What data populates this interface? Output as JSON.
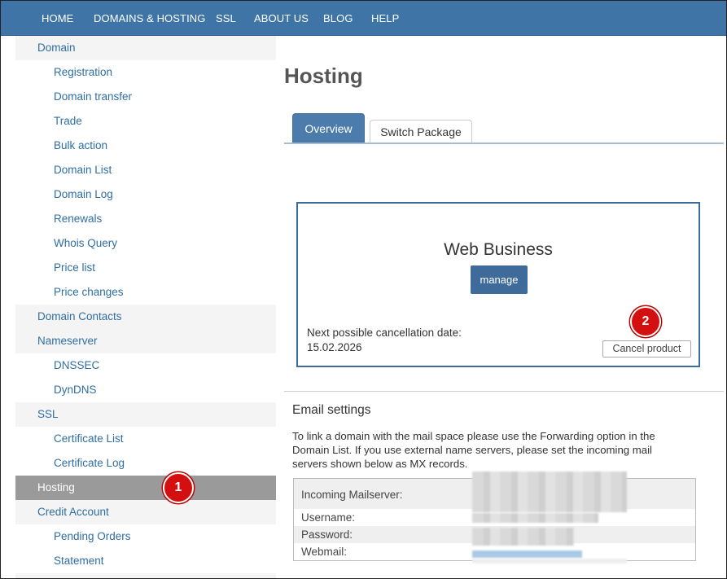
{
  "topnav": {
    "items": [
      "HOME",
      "DOMAINS & HOSTING",
      "SSL",
      "ABOUT US",
      "BLOG",
      "HELP"
    ]
  },
  "sidebar": {
    "items": [
      {
        "label": "Domain",
        "level": 1
      },
      {
        "label": "Registration",
        "level": 2
      },
      {
        "label": "Domain transfer",
        "level": 2
      },
      {
        "label": "Trade",
        "level": 2
      },
      {
        "label": "Bulk action",
        "level": 2
      },
      {
        "label": "Domain List",
        "level": 2
      },
      {
        "label": "Domain Log",
        "level": 2
      },
      {
        "label": "Renewals",
        "level": 2
      },
      {
        "label": "Whois Query",
        "level": 2
      },
      {
        "label": "Price list",
        "level": 2
      },
      {
        "label": "Price changes",
        "level": 2
      },
      {
        "label": "Domain Contacts",
        "level": 1
      },
      {
        "label": "Nameserver",
        "level": 1
      },
      {
        "label": "DNSSEC",
        "level": 2
      },
      {
        "label": "DynDNS",
        "level": 2
      },
      {
        "label": "SSL",
        "level": 1
      },
      {
        "label": "Certificate List",
        "level": 2
      },
      {
        "label": "Certificate Log",
        "level": 2
      },
      {
        "label": "Hosting",
        "level": 1,
        "active": true
      },
      {
        "label": "Credit Account",
        "level": 1
      },
      {
        "label": "Pending Orders",
        "level": 2
      },
      {
        "label": "Statement",
        "level": 2
      }
    ]
  },
  "annotations": {
    "badge1": "1",
    "badge2": "2"
  },
  "main": {
    "title": "Hosting",
    "tabs": [
      {
        "label": "Overview",
        "active": true
      },
      {
        "label": "Switch Package",
        "active": false
      }
    ],
    "package": {
      "name": "Web Business",
      "manage_label": "manage",
      "cancellation_label": "Next possible cancellation date:",
      "cancellation_date": "15.02.2026",
      "cancel_label": "Cancel product"
    },
    "email": {
      "title": "Email settings",
      "description": "To link a domain with the mail space please use the Forwarding option in the Domain List. If you use external name servers, please set the incoming mail servers shown below as MX records.",
      "rows": [
        {
          "label": "Incoming Mailserver:"
        },
        {
          "label": "Username:"
        },
        {
          "label": "Password:"
        },
        {
          "label": "Webmail:"
        }
      ]
    }
  },
  "colors": {
    "brand": "#3f74a7",
    "sidebar_link": "#2f6ea3",
    "active_bg": "#9a9a9a",
    "badge": "#d40f0f"
  }
}
